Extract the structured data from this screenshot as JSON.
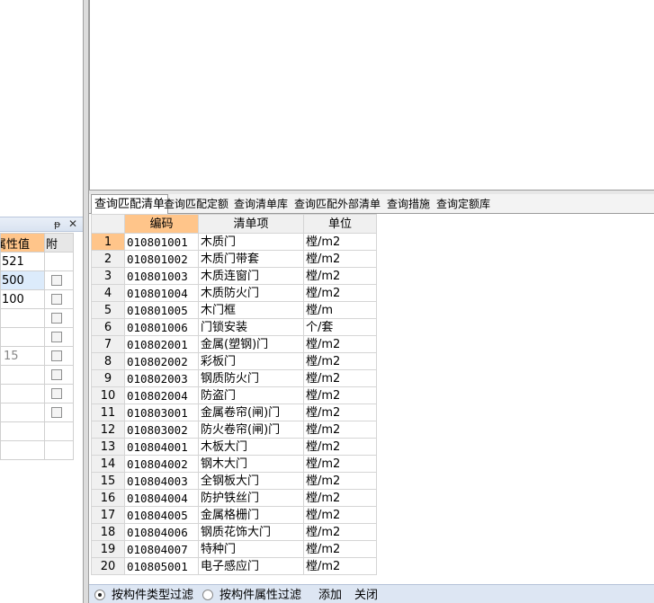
{
  "property_panel": {
    "pin_glyph": "ᵽ",
    "close_glyph": "✕",
    "header_value": "属性值",
    "header_extra": "附",
    "rows": [
      {
        "value": "521",
        "checkbox": false
      },
      {
        "value": "500",
        "checkbox": true
      },
      {
        "value": "100",
        "checkbox": true
      },
      {
        "value": "",
        "checkbox": true
      },
      {
        "value": "",
        "checkbox": true
      },
      {
        "value": "15",
        "checkbox": true
      },
      {
        "value": "",
        "checkbox": true
      },
      {
        "value": "",
        "checkbox": true
      },
      {
        "value": "",
        "checkbox": true
      },
      {
        "value": "",
        "checkbox": false
      },
      {
        "value": "",
        "checkbox": false
      }
    ]
  },
  "tabs": [
    {
      "label": "查询匹配清单",
      "active": true
    },
    {
      "label": "查询匹配定额",
      "active": false
    },
    {
      "label": "查询清单库",
      "active": false
    },
    {
      "label": "查询匹配外部清单",
      "active": false
    },
    {
      "label": "查询措施",
      "active": false
    },
    {
      "label": "查询定额库",
      "active": false
    }
  ],
  "grid": {
    "columns": [
      "",
      "编码",
      "清单项",
      "单位"
    ],
    "rows": [
      {
        "no": "1",
        "code": "010801001",
        "name": "木质门",
        "unit": "樘/m2"
      },
      {
        "no": "2",
        "code": "010801002",
        "name": "木质门带套",
        "unit": "樘/m2"
      },
      {
        "no": "3",
        "code": "010801003",
        "name": "木质连窗门",
        "unit": "樘/m2"
      },
      {
        "no": "4",
        "code": "010801004",
        "name": "木质防火门",
        "unit": "樘/m2"
      },
      {
        "no": "5",
        "code": "010801005",
        "name": "木门框",
        "unit": "樘/m"
      },
      {
        "no": "6",
        "code": "010801006",
        "name": "门锁安装",
        "unit": "个/套"
      },
      {
        "no": "7",
        "code": "010802001",
        "name": "金属(塑钢)门",
        "unit": "樘/m2"
      },
      {
        "no": "8",
        "code": "010802002",
        "name": "彩板门",
        "unit": "樘/m2"
      },
      {
        "no": "9",
        "code": "010802003",
        "name": "钢质防火门",
        "unit": "樘/m2"
      },
      {
        "no": "10",
        "code": "010802004",
        "name": "防盗门",
        "unit": "樘/m2"
      },
      {
        "no": "11",
        "code": "010803001",
        "name": "金属卷帘(闸)门",
        "unit": "樘/m2"
      },
      {
        "no": "12",
        "code": "010803002",
        "name": "防火卷帘(闸)门",
        "unit": "樘/m2"
      },
      {
        "no": "13",
        "code": "010804001",
        "name": "木板大门",
        "unit": "樘/m2"
      },
      {
        "no": "14",
        "code": "010804002",
        "name": "钢木大门",
        "unit": "樘/m2"
      },
      {
        "no": "15",
        "code": "010804003",
        "name": "全钢板大门",
        "unit": "樘/m2"
      },
      {
        "no": "16",
        "code": "010804004",
        "name": "防护铁丝门",
        "unit": "樘/m2"
      },
      {
        "no": "17",
        "code": "010804005",
        "name": "金属格栅门",
        "unit": "樘/m2"
      },
      {
        "no": "18",
        "code": "010804006",
        "name": "钢质花饰大门",
        "unit": "樘/m2"
      },
      {
        "no": "19",
        "code": "010804007",
        "name": "特种门",
        "unit": "樘/m2"
      },
      {
        "no": "20",
        "code": "010805001",
        "name": "电子感应门",
        "unit": "樘/m2"
      }
    ]
  },
  "bottom_bar": {
    "radio_by_type": "按构件类型过滤",
    "radio_by_attr": "按构件属性过滤",
    "add_label": "添加",
    "close_label": "关闭"
  }
}
